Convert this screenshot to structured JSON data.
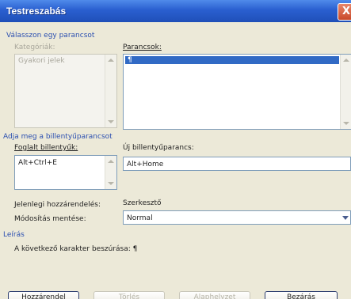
{
  "window": {
    "title": "Testreszabás",
    "close_glyph": "X"
  },
  "command_section": {
    "heading": "Válasszon egy parancsot",
    "categories_label": "Kategóriák:",
    "categories_item": "Gyakori jelek",
    "commands_label": "Parancsok:",
    "commands_selected": "¶"
  },
  "shortcut_section": {
    "heading": "Adja meg a billentyűparancsot",
    "current_keys_label": "Foglalt billentyűk:",
    "current_keys_value": "Alt+Ctrl+E",
    "new_shortcut_label": "Új billentyűparancs:",
    "new_shortcut_value": "Alt+Home",
    "assigned_label": "Jelenlegi hozzárendelés:",
    "assigned_value": "Szerkesztő",
    "save_in_label": "Módosítás mentése:",
    "save_in_value": "Normal"
  },
  "description": {
    "heading": "Leírás",
    "text": "A következő karakter beszúrása: ¶"
  },
  "buttons": {
    "assign": "Hozzárendel",
    "remove": "Törlés",
    "reset_all": "Alaphelyzet",
    "close": "Bezárás"
  }
}
